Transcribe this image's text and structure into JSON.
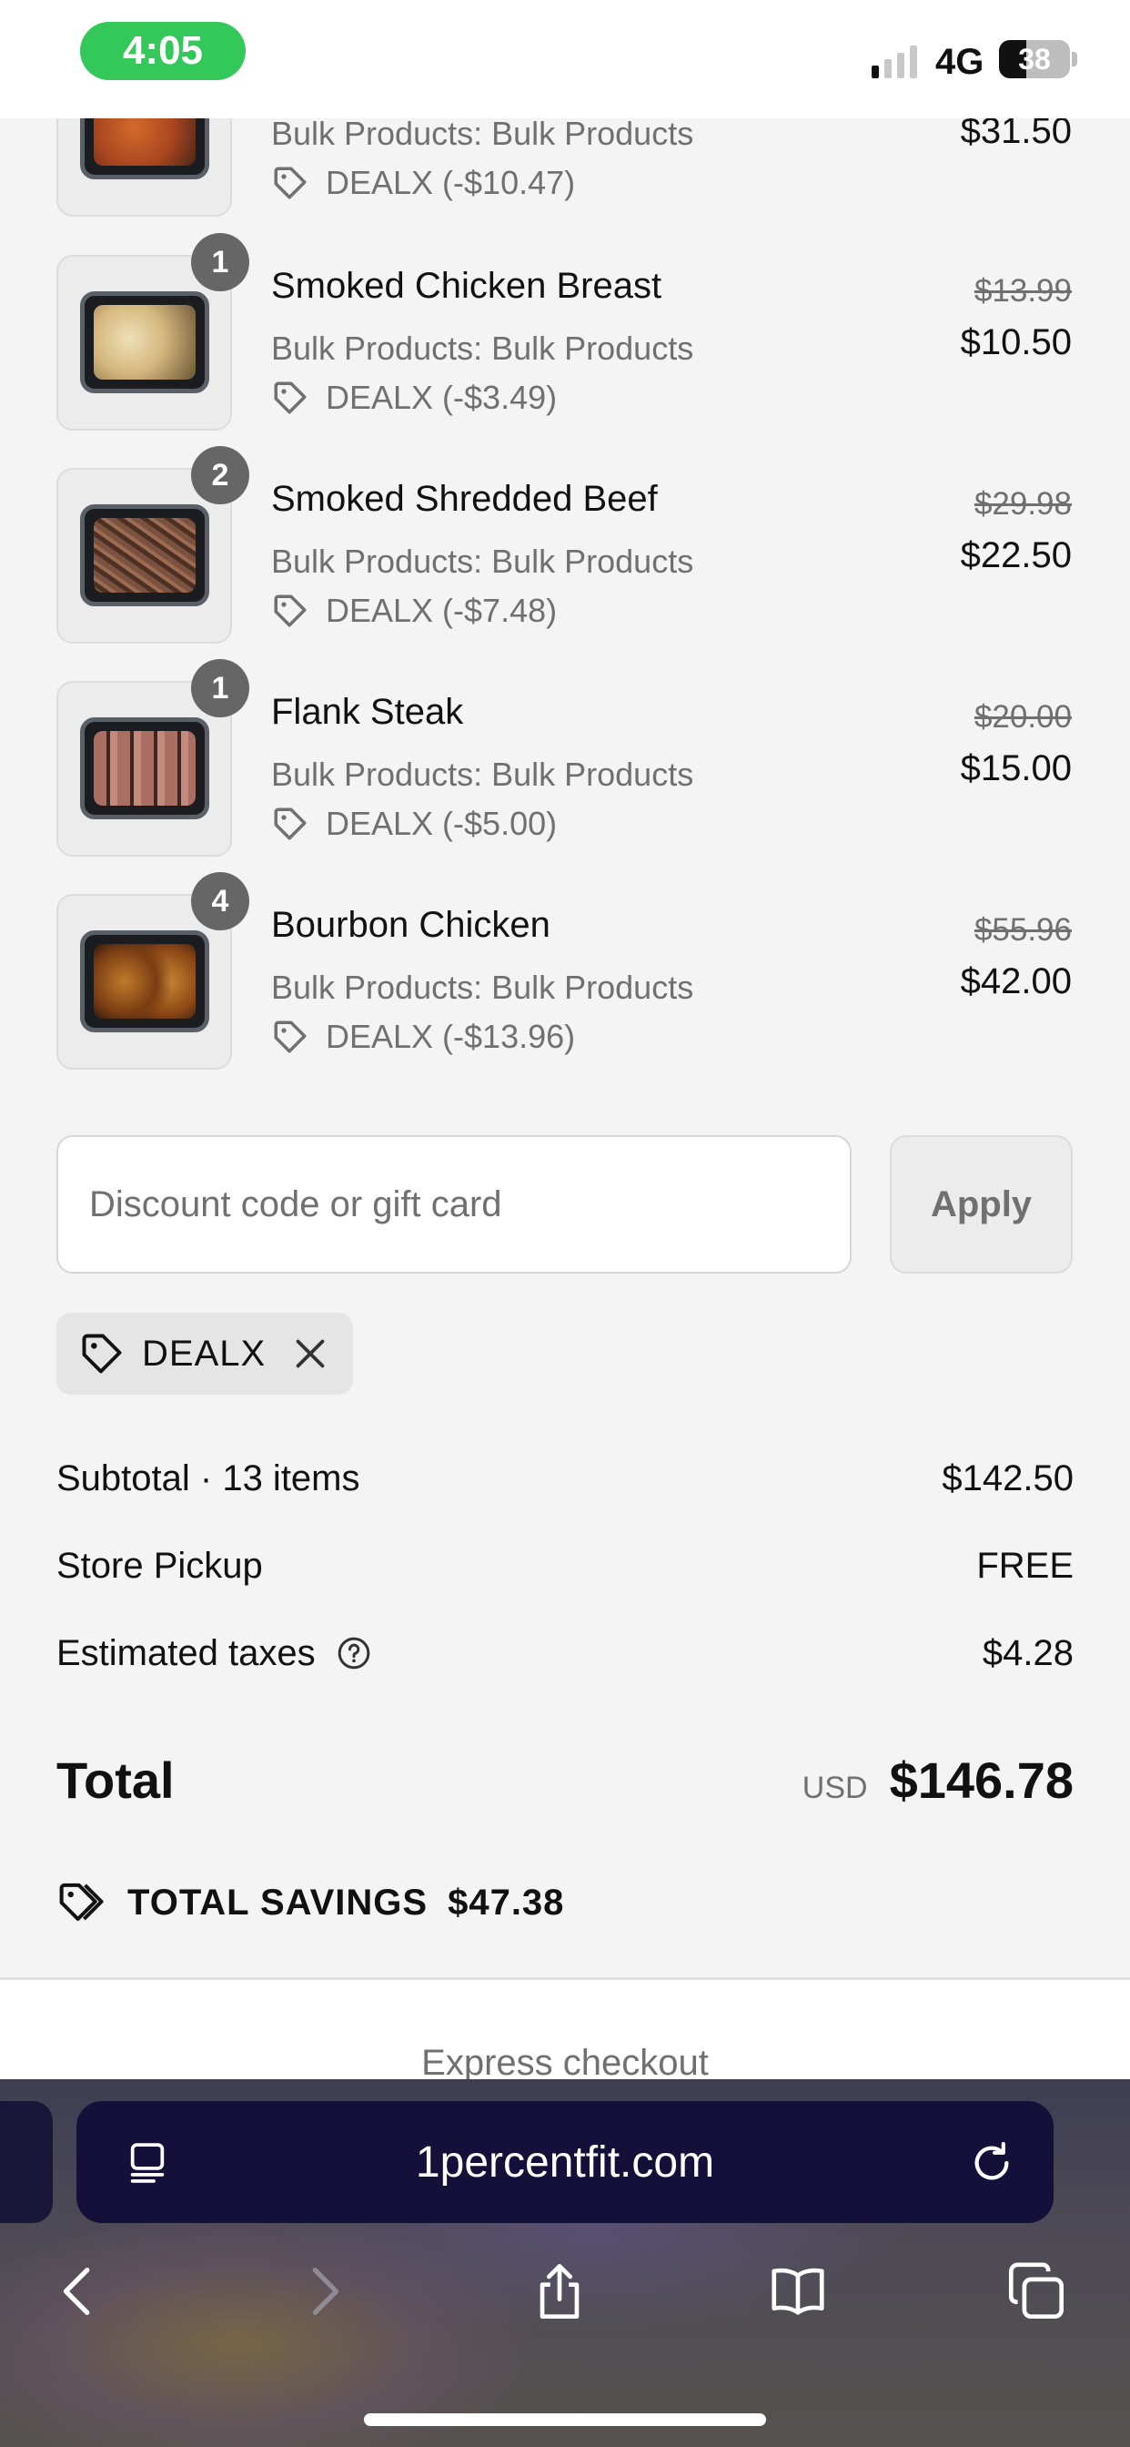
{
  "status_bar": {
    "time": "4:05",
    "network": "4G",
    "battery": "38"
  },
  "line_items": [
    {
      "quantity": "",
      "name": "",
      "variant": "Bulk Products: Bulk Products",
      "discount": "DEALX (-$10.47)",
      "original_price": "",
      "price": "$31.50",
      "food_color": "#b5542a"
    },
    {
      "quantity": "1",
      "name": "Smoked Chicken Breast",
      "variant": "Bulk Products: Bulk Products",
      "discount": "DEALX (-$3.49)",
      "original_price": "$13.99",
      "price": "$10.50",
      "food_color": "#d9c08a"
    },
    {
      "quantity": "2",
      "name": "Smoked Shredded Beef",
      "variant": "Bulk Products: Bulk Products",
      "discount": "DEALX (-$7.48)",
      "original_price": "$29.98",
      "price": "$22.50",
      "food_color": "#6e4a38"
    },
    {
      "quantity": "1",
      "name": "Flank Steak",
      "variant": "Bulk Products: Bulk Products",
      "discount": "DEALX (-$5.00)",
      "original_price": "$20.00",
      "price": "$15.00",
      "food_color": "#8a5a4e"
    },
    {
      "quantity": "4",
      "name": "Bourbon Chicken",
      "variant": "Bulk Products: Bulk Products",
      "discount": "DEALX (-$13.96)",
      "original_price": "$55.96",
      "price": "$42.00",
      "food_color": "#9a5a22"
    }
  ],
  "discount_form": {
    "placeholder": "Discount code or gift card",
    "apply_label": "Apply"
  },
  "applied_code": {
    "code": "DEALX"
  },
  "summary": {
    "subtotal_label": "Subtotal · 13 items",
    "subtotal_value": "$142.50",
    "shipping_label": "Store Pickup",
    "shipping_value": "FREE",
    "taxes_label": "Estimated taxes",
    "taxes_value": "$4.28",
    "total_label": "Total",
    "currency": "USD",
    "total_value": "$146.78",
    "savings_label": "TOTAL SAVINGS",
    "savings_value": "$47.38"
  },
  "express_checkout_label": "Express checkout",
  "browser": {
    "url": "1percentfit.com"
  },
  "icons": {
    "discount_tag": "tag-icon",
    "remove_code": "close-icon",
    "taxes_help": "question-circle-icon",
    "reader": "reader-mode-icon",
    "reload": "reload-icon",
    "back": "chevron-left-icon",
    "forward": "chevron-right-icon",
    "share": "share-icon",
    "bookmarks": "book-icon",
    "tabs": "tabs-icon"
  }
}
